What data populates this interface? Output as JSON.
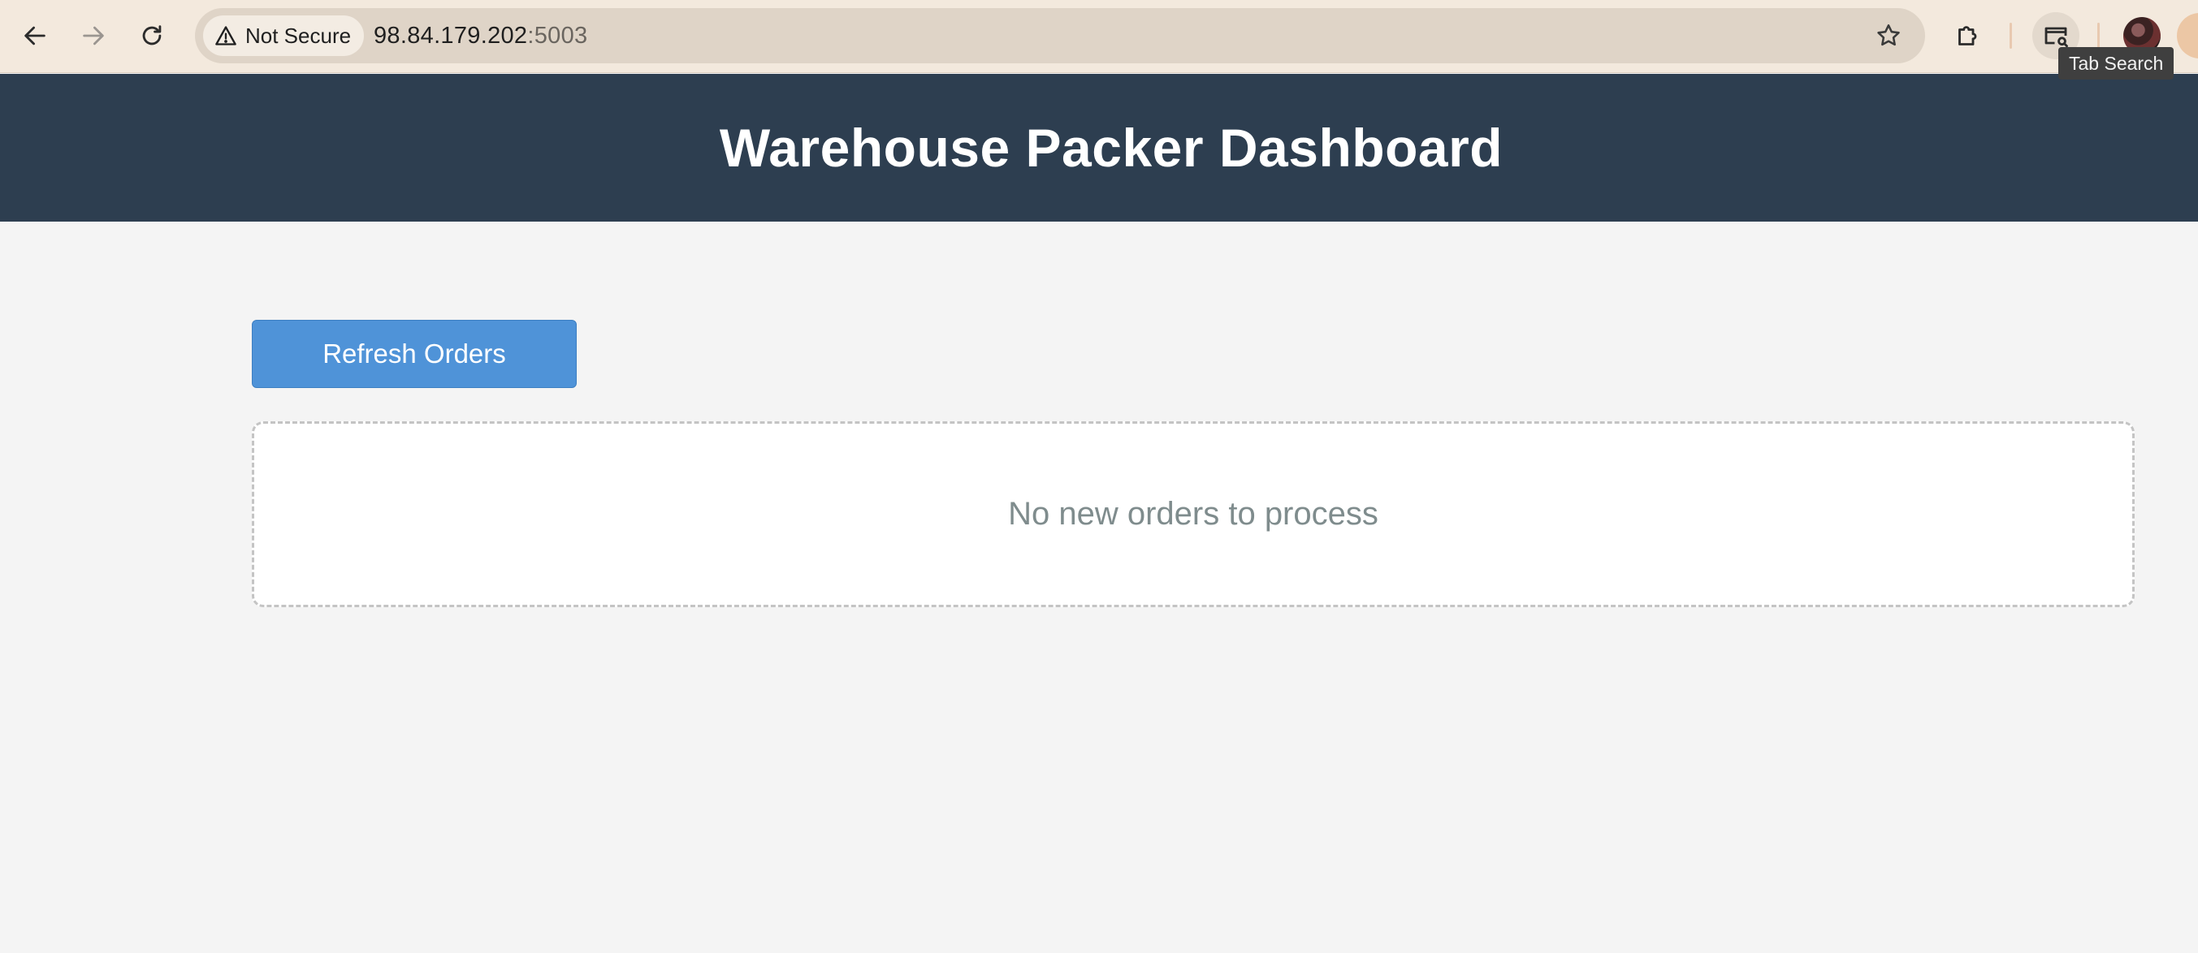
{
  "browser": {
    "security_label": "Not Secure",
    "url_host": "98.84.179.202",
    "url_port": ":5003",
    "tooltip": "Tab Search",
    "icons": {
      "back": "arrow-left-icon",
      "forward": "arrow-right-icon",
      "reload": "reload-icon",
      "warning": "warning-triangle-icon",
      "bookmark": "star-icon",
      "extensions": "puzzle-icon",
      "tab_search": "tab-search-icon"
    }
  },
  "header": {
    "title": "Warehouse Packer Dashboard",
    "background": "#2d3e50"
  },
  "main": {
    "refresh_label": "Refresh Orders",
    "refresh_color": "#4f93d8",
    "empty_message": "No new orders to process"
  }
}
